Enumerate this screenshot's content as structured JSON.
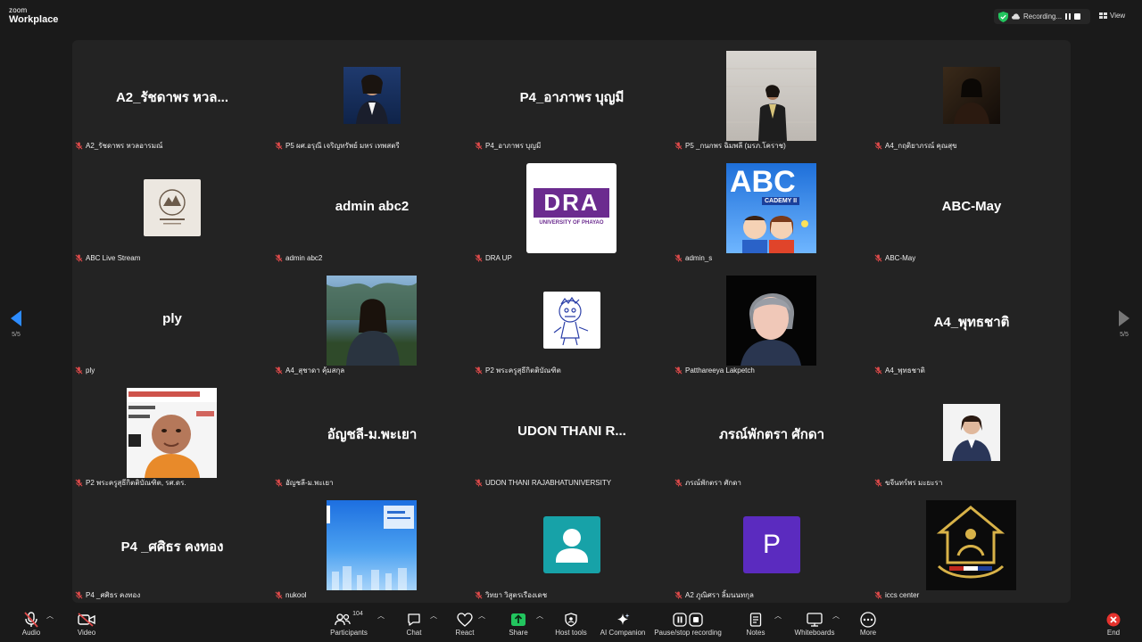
{
  "app": {
    "brand_small": "zoom",
    "brand_big": "Workplace"
  },
  "recording": {
    "label": "Recording..."
  },
  "view": {
    "label": "View"
  },
  "nav": {
    "left_count": "5/5",
    "right_count": "5/5"
  },
  "colors": {
    "accent_blue": "#2d8cff",
    "mic_muted": "#e04a4a",
    "shield_green": "#22c55e",
    "end_red": "#e5322d"
  },
  "tiles": [
    {
      "display": "name",
      "big": "A2_รัชดาพร หวล...",
      "label": "A2_รัชดาพร หวลอารมณ์"
    },
    {
      "display": "photo",
      "label": "P5 ผศ.อรุณี เจริญทรัพย์ มหร เทพสตรี"
    },
    {
      "display": "name",
      "big": "P4_อาภาพร บุญมี",
      "label": "P4_อาภาพร บุญมี"
    },
    {
      "display": "photo",
      "label": "P5 _กนกพร ฉิมพลี (มรภ.โคราช)"
    },
    {
      "display": "photo",
      "label": "A4_กฤติยาภรณ์ คุณสุข"
    },
    {
      "display": "logo",
      "label": "ABC Live Stream"
    },
    {
      "display": "name",
      "big": "admin abc2",
      "label": "admin abc2"
    },
    {
      "display": "logo",
      "label": "DRA UP",
      "logo_text": "DRA",
      "logo_sub": "UNIVERSITY OF PHAYAO"
    },
    {
      "display": "logo",
      "label": "admin_s",
      "logo_text": "ABC",
      "logo_sub": "CADEMY II"
    },
    {
      "display": "name",
      "big": "ABC-May",
      "label": "ABC-May"
    },
    {
      "display": "name",
      "big": "ply",
      "label": "ply"
    },
    {
      "display": "photo",
      "label": "A4_สุชาดา คุ้มสกุล"
    },
    {
      "display": "photo",
      "label": "P2 พระครูสุธีกิตติบัณฑิต"
    },
    {
      "display": "photo",
      "label": "Patthareeya Lakpetch"
    },
    {
      "display": "name",
      "big": "A4_พุทธชาติ",
      "label": "A4_พุทธชาติ"
    },
    {
      "display": "photo",
      "label": "P2 พระครูสุธีกิตติบัณฑิต, รศ.ดร."
    },
    {
      "display": "name",
      "big": "อัญชลี-ม.พะเยา",
      "label": "อัญชลี-ม.พะเยา"
    },
    {
      "display": "name",
      "big": "UDON THANI R...",
      "label": "UDON THANI RAJABHATUNIVERSITY"
    },
    {
      "display": "name",
      "big": "ภรณ์พักตรา ศักดา",
      "label": "ภรณ์พักตรา ศักดา"
    },
    {
      "display": "photo",
      "label": "ขจีนทร์พร มะยะรา"
    },
    {
      "display": "name",
      "big": "P4 _ศศิธร คงทอง",
      "label": "P4 _ศศิธร คงทอง"
    },
    {
      "display": "photo",
      "label": "nukool"
    },
    {
      "display": "avatar",
      "label": "วิทยา วิสูตรเรืองเดช"
    },
    {
      "display": "avatar",
      "label": "A2 ภูณิศรา ลิ้มนนทกุล",
      "initial": "P"
    },
    {
      "display": "logo",
      "label": "iccs center"
    }
  ],
  "toolbar": {
    "audio": "Audio",
    "video": "Video",
    "participants": "Participants",
    "participants_count": "104",
    "chat": "Chat",
    "react": "React",
    "share": "Share",
    "host_tools": "Host tools",
    "ai_companion": "AI Companion",
    "pause_stop": "Pause/stop recording",
    "notes": "Notes",
    "whiteboards": "Whiteboards",
    "more": "More",
    "end": "End"
  }
}
